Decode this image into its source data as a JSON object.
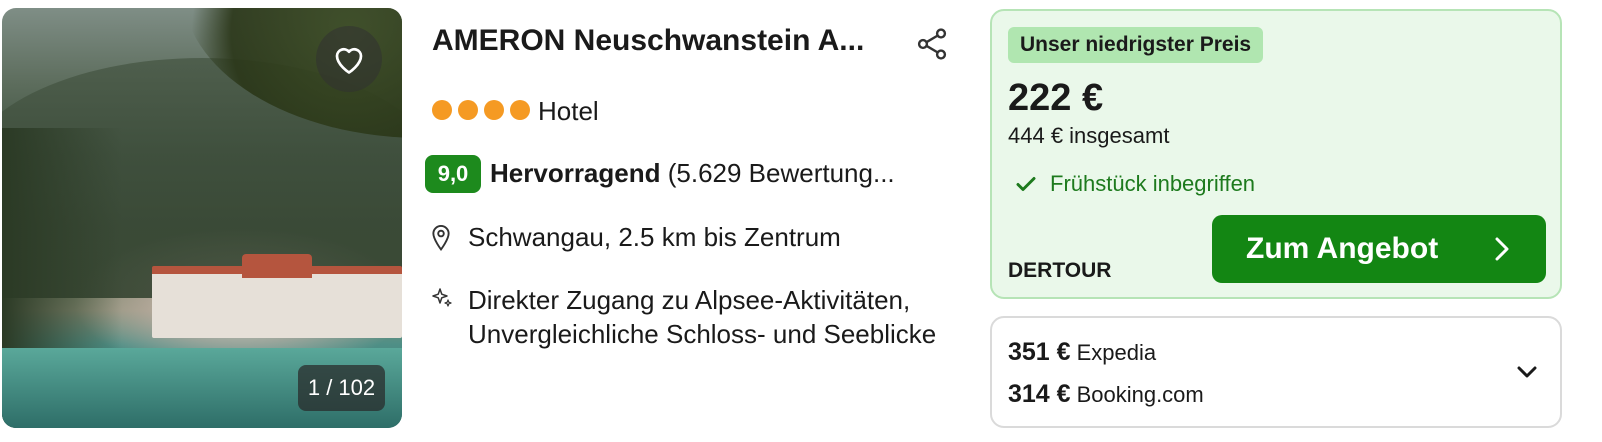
{
  "listing": {
    "name": "AMERON Neuschwanstein A...",
    "star_count": 4,
    "property_type": "Hotel",
    "photo_counter": "1 / 102",
    "rating": {
      "score": "9,0",
      "label": "Hervorragend",
      "reviews": "(5.629 Bewertung..."
    },
    "location": "Schwangau, 2.5 km bis Zentrum",
    "highlights": [
      "Direkter Zugang zu Alpsee-Aktivitäten,",
      "Unvergleichliche Schloss- und Seeblicke"
    ]
  },
  "offer": {
    "badge": "Unser niedrigster Preis",
    "price": "222 €",
    "total": "444 € insgesamt",
    "breakfast": "Frühstück inbegriffen",
    "provider": "DERTOUR",
    "cta_label": "Zum Angebot"
  },
  "other_offers": [
    {
      "price": "351 €",
      "provider": "Expedia"
    },
    {
      "price": "314 €",
      "provider": "Booking.com"
    }
  ],
  "colors": {
    "rating_green": "#1d8a1d",
    "cta_green": "#138613",
    "offer_bg": "#eaf8ea",
    "star_orange": "#f59a23"
  },
  "icons": [
    "heart-icon",
    "share-icon",
    "location-pin-icon",
    "sparkle-icon",
    "check-icon",
    "chevron-right-icon",
    "chevron-down-icon"
  ]
}
